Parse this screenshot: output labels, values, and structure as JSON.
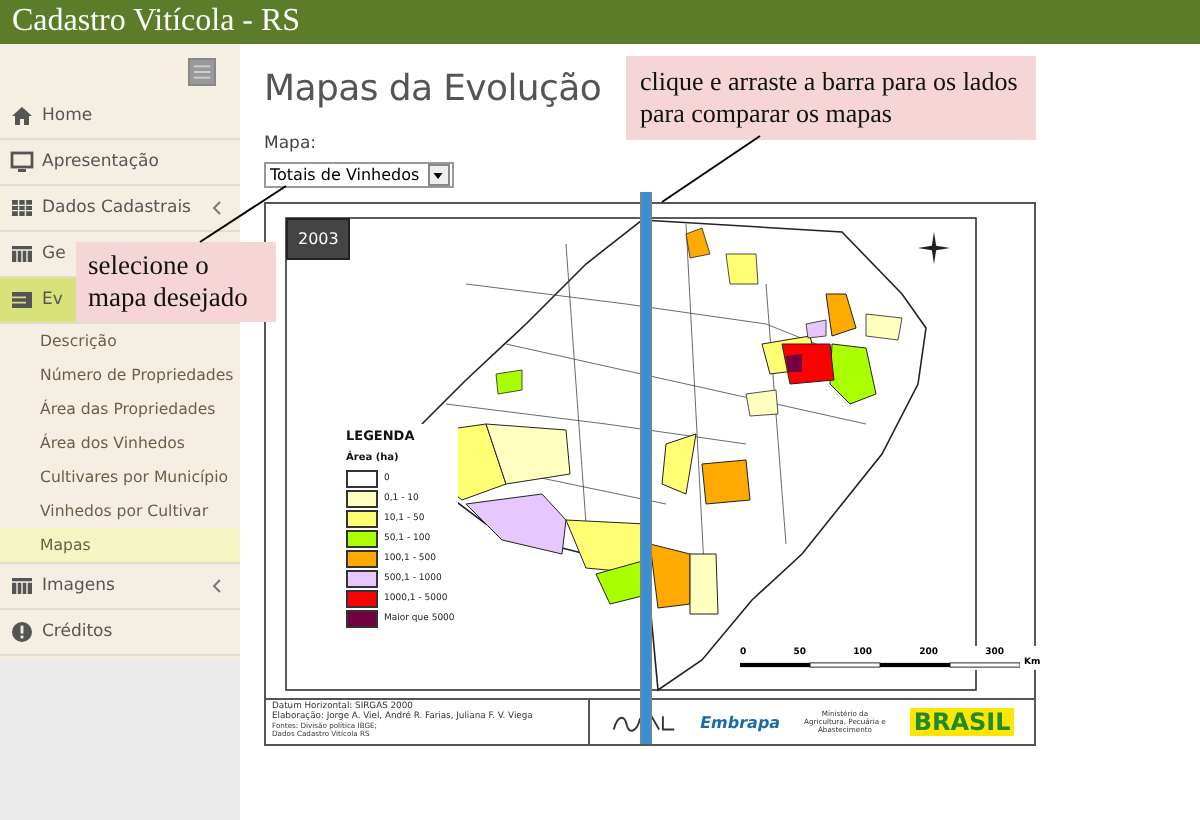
{
  "header": {
    "title": "Cadastro Vitícola - RS"
  },
  "sidebar": {
    "items": [
      {
        "label": "Home",
        "has_submenu": false,
        "selected": false
      },
      {
        "label": "Apresentação",
        "has_submenu": false,
        "selected": false
      },
      {
        "label": "Dados Cadastrais",
        "has_submenu": true,
        "selected": false
      },
      {
        "label": "Ge",
        "has_submenu": false,
        "selected": false
      },
      {
        "label": "Ev",
        "has_submenu": false,
        "selected": true,
        "children": [
          {
            "label": "Descrição",
            "selected": false
          },
          {
            "label": "Número de Propriedades",
            "selected": false
          },
          {
            "label": "Área das Propriedades",
            "selected": false
          },
          {
            "label": "Área dos Vinhedos",
            "selected": false
          },
          {
            "label": "Cultivares por Município",
            "selected": false
          },
          {
            "label": "Vinhedos por Cultivar",
            "selected": false
          },
          {
            "label": "Mapas",
            "selected": true
          }
        ]
      },
      {
        "label": "Imagens",
        "has_submenu": true,
        "selected": false
      },
      {
        "label": "Créditos",
        "has_submenu": false,
        "selected": false
      }
    ]
  },
  "page": {
    "title": "Mapas da Evolução",
    "map_label": "Mapa:",
    "map_select": {
      "value": "Totais de Vinhedos"
    }
  },
  "map": {
    "year": "2003",
    "legend_title": "LEGENDA",
    "legend_subtitle": "Área (ha)",
    "legend": [
      {
        "label": "0",
        "color": "#ffffff"
      },
      {
        "label": "0,1 - 10",
        "color": "#ffffc0"
      },
      {
        "label": "10,1 - 50",
        "color": "#ffff73"
      },
      {
        "label": "50,1 - 100",
        "color": "#aaff00"
      },
      {
        "label": "100,1 - 500",
        "color": "#ffaa00"
      },
      {
        "label": "500,1 - 1000",
        "color": "#e6c8ff"
      },
      {
        "label": "1000,1 - 5000",
        "color": "#ff0000"
      },
      {
        "label": "Maior que 5000",
        "color": "#730040"
      }
    ],
    "scale_labels": [
      "0",
      "50",
      "100",
      "200",
      "300"
    ],
    "scale_unit": "Km",
    "footer_lines": [
      "Datum Horizontal: SIRGAS 2000",
      "Elaboração: Jorge A. Viel, André R. Farias, Juliana F. V. Viega",
      "Fontes: Divisão política IBGE;",
      "Dados Cadastro Vitícola RS"
    ],
    "logos": {
      "embrapa": "Embrapa",
      "ministry": "Ministério da Agricultura, Pecuária e Abastecimento",
      "country": "BRASIL"
    }
  },
  "callouts": [
    {
      "text": "selecione o mapa desejado"
    },
    {
      "text": "clique e arraste a barra para os lados para comparar os mapas"
    }
  ]
}
